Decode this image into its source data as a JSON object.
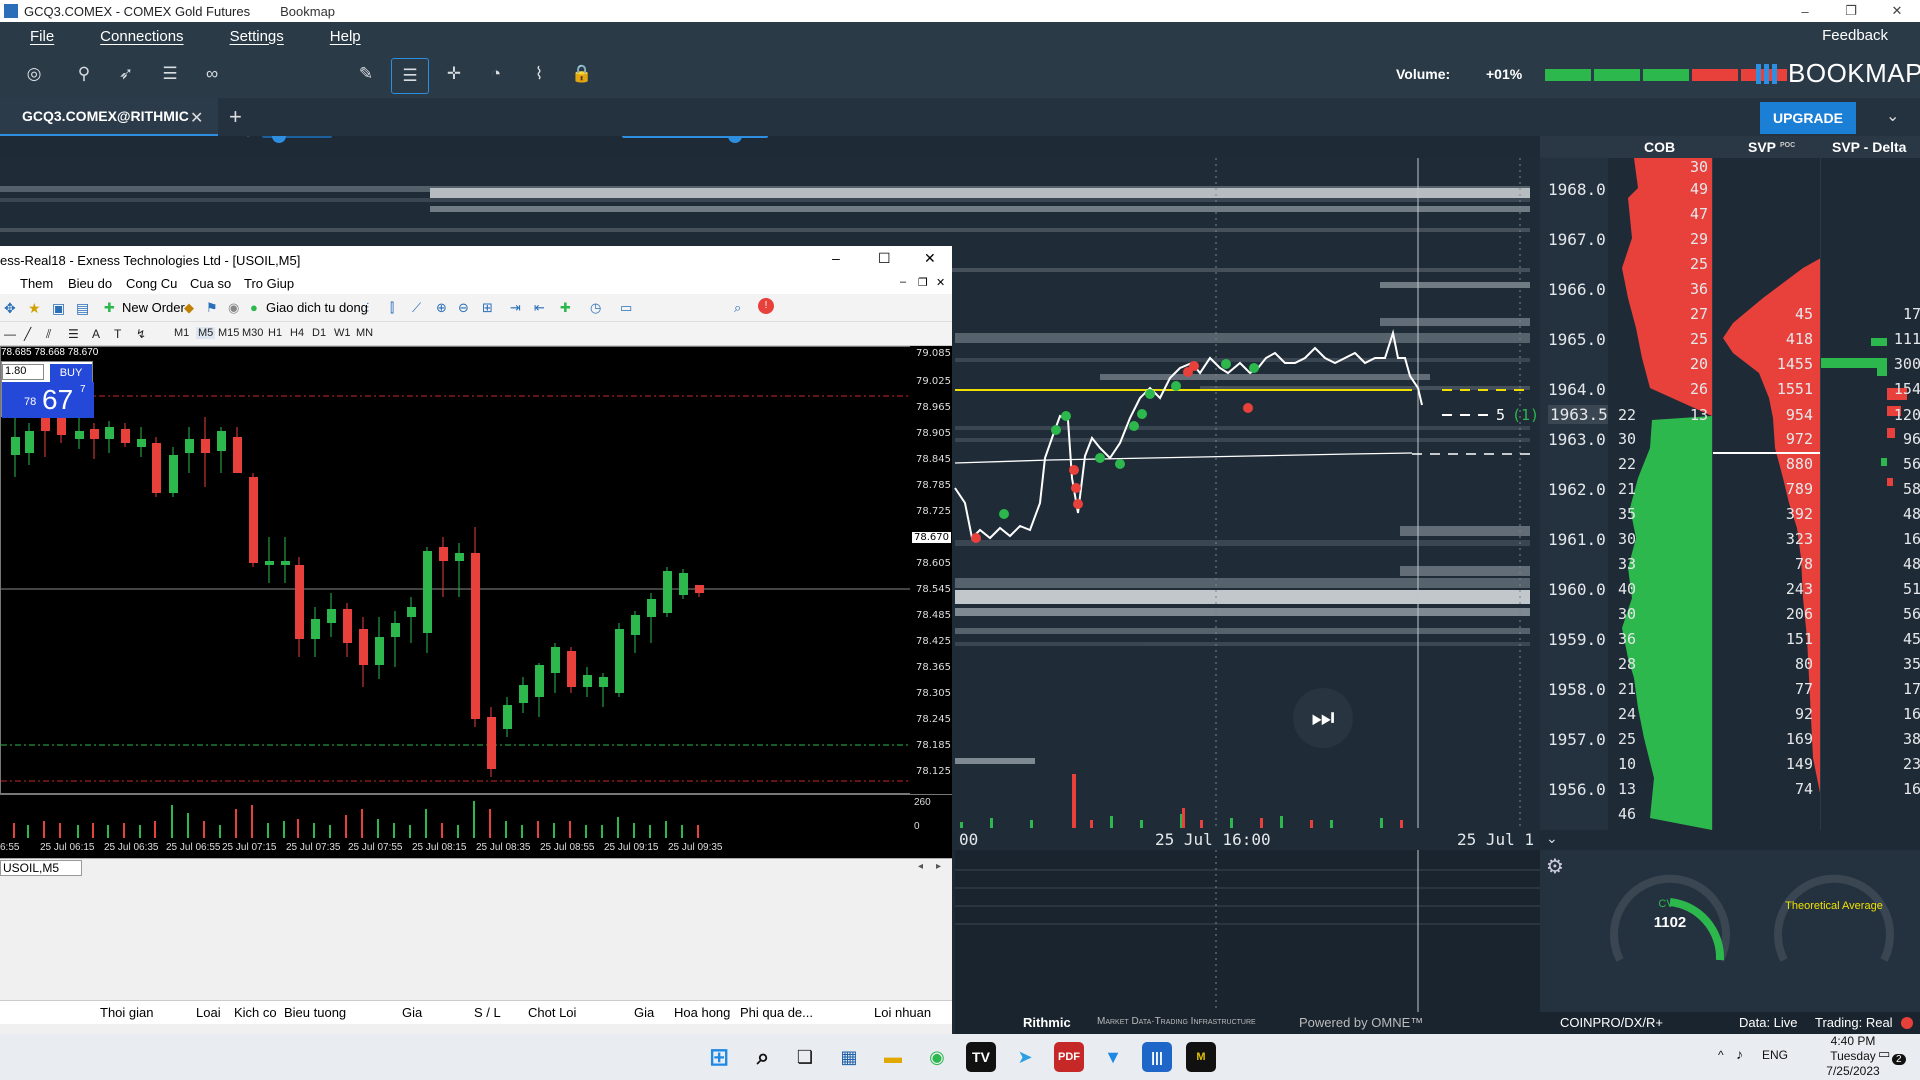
{
  "window": {
    "title": "GCQ3.COMEX - COMEX Gold Futures",
    "app": "Bookmap",
    "controls": [
      "–",
      "❐",
      "✕"
    ]
  },
  "menu": [
    "File",
    "Connections",
    "Settings",
    "Help"
  ],
  "feedback_label": "Feedback",
  "toolbar": {
    "volume_label": "Volume:",
    "volume_pct": "+01%",
    "logo": "BOOKMAP"
  },
  "tabs": {
    "main": "GCQ3.COMEX@RITHMIC",
    "close": "✕",
    "add": "+"
  },
  "upgrade_label": "UPGRADE",
  "columns": {
    "cob": "COB",
    "svp": "SVP",
    "svp_poc": "POC",
    "svp_delta": "SVP - Delta"
  },
  "prices": [
    "1968.0",
    "1967.0",
    "1966.0",
    "1965.0",
    "1964.0",
    "1963.5",
    "1963.0",
    "1962.0",
    "1961.0",
    "1960.0",
    "1959.0",
    "1958.0",
    "1957.0",
    "1956.0"
  ],
  "cob_values": [
    "30",
    "49",
    "47",
    "29",
    "25",
    "36",
    "27",
    "25",
    "20",
    "26",
    "13",
    "22",
    "30",
    "22",
    "21",
    "35",
    "30",
    "33",
    "40",
    "30",
    "36",
    "28",
    "21",
    "24",
    "25",
    "10",
    "13",
    "46"
  ],
  "svp_values": [
    "45",
    "418",
    "1455",
    "1551",
    "954",
    "972",
    "880",
    "789",
    "392",
    "323",
    "78",
    "243",
    "206",
    "151",
    "80",
    "77",
    "92",
    "169",
    "149",
    "74"
  ],
  "svpd_values": [
    "17",
    "111",
    "300",
    "154",
    "120",
    "96",
    "56",
    "58",
    "48",
    "16",
    "48",
    "51",
    "56",
    "45",
    "35",
    "17",
    "16",
    "38",
    "23",
    "16"
  ],
  "order_marker": "5",
  "order_marker_count": "(1)",
  "time_labels": [
    "00",
    "25 Jul 16:00",
    "25 Jul 1"
  ],
  "indicators": {
    "cvd_label": "CVD",
    "cvd_value": "1102",
    "theo_label": "Theoretical Average"
  },
  "bottom": {
    "rithmic": "Rithmic",
    "rithmic_tag": "Market Data·Trading Infrastructure",
    "omne": "Powered by OMNE™",
    "account": "COINPRO/DX/R+",
    "data": "Data: Live",
    "trading": "Trading: Real"
  },
  "mt4": {
    "title": "ess-Real18 - Exness Technologies Ltd - [USOIL,M5]",
    "menu": [
      "Them",
      "Bieu do",
      "Cong Cu",
      "Cua so",
      "Tro Giup"
    ],
    "new_order": "New Order",
    "auto_trading": "Giao dich tu dong",
    "timeframes": [
      "M1",
      "M5",
      "M15",
      "M30",
      "H1",
      "H4",
      "D1",
      "W1",
      "MN"
    ],
    "ohlc": "78.685 78.668 78.670",
    "lot": "1.80",
    "buy": "BUY",
    "price_big_prefix": "78",
    "price_big": "67",
    "price_sup": "7",
    "yaxis": [
      "79.085",
      "79.025",
      "78.965",
      "78.905",
      "78.845",
      "78.785",
      "78.725",
      "78.670",
      "78.605",
      "78.545",
      "78.485",
      "78.425",
      "78.365",
      "78.305",
      "78.245",
      "78.185",
      "78.125"
    ],
    "vol_axis": [
      "260",
      "0"
    ],
    "xaxis": [
      "6:55",
      "25 Jul 06:15",
      "25 Jul 06:35",
      "25 Jul 06:55",
      "25 Jul 07:15",
      "25 Jul 07:35",
      "25 Jul 07:55",
      "25 Jul 08:15",
      "25 Jul 08:35",
      "25 Jul 08:55",
      "25 Jul 09:15",
      "25 Jul 09:35"
    ],
    "tab": "USOIL,M5",
    "columns": [
      "Thoi gian",
      "Loai",
      "Kich co",
      "Bieu tuong",
      "Gia",
      "S / L",
      "Chot Loi",
      "Gia",
      "Hoa hong",
      "Phi qua de...",
      "Loi nhuan"
    ]
  },
  "taskbar": {
    "time": "4:40 PM",
    "day": "Tuesday",
    "date": "7/25/2023",
    "lang": "ENG",
    "notif": "2"
  },
  "colors": {
    "accent": "#2e8ee0",
    "bid": "#2db84d",
    "ask": "#e8413c",
    "bg": "#1e2a35"
  }
}
